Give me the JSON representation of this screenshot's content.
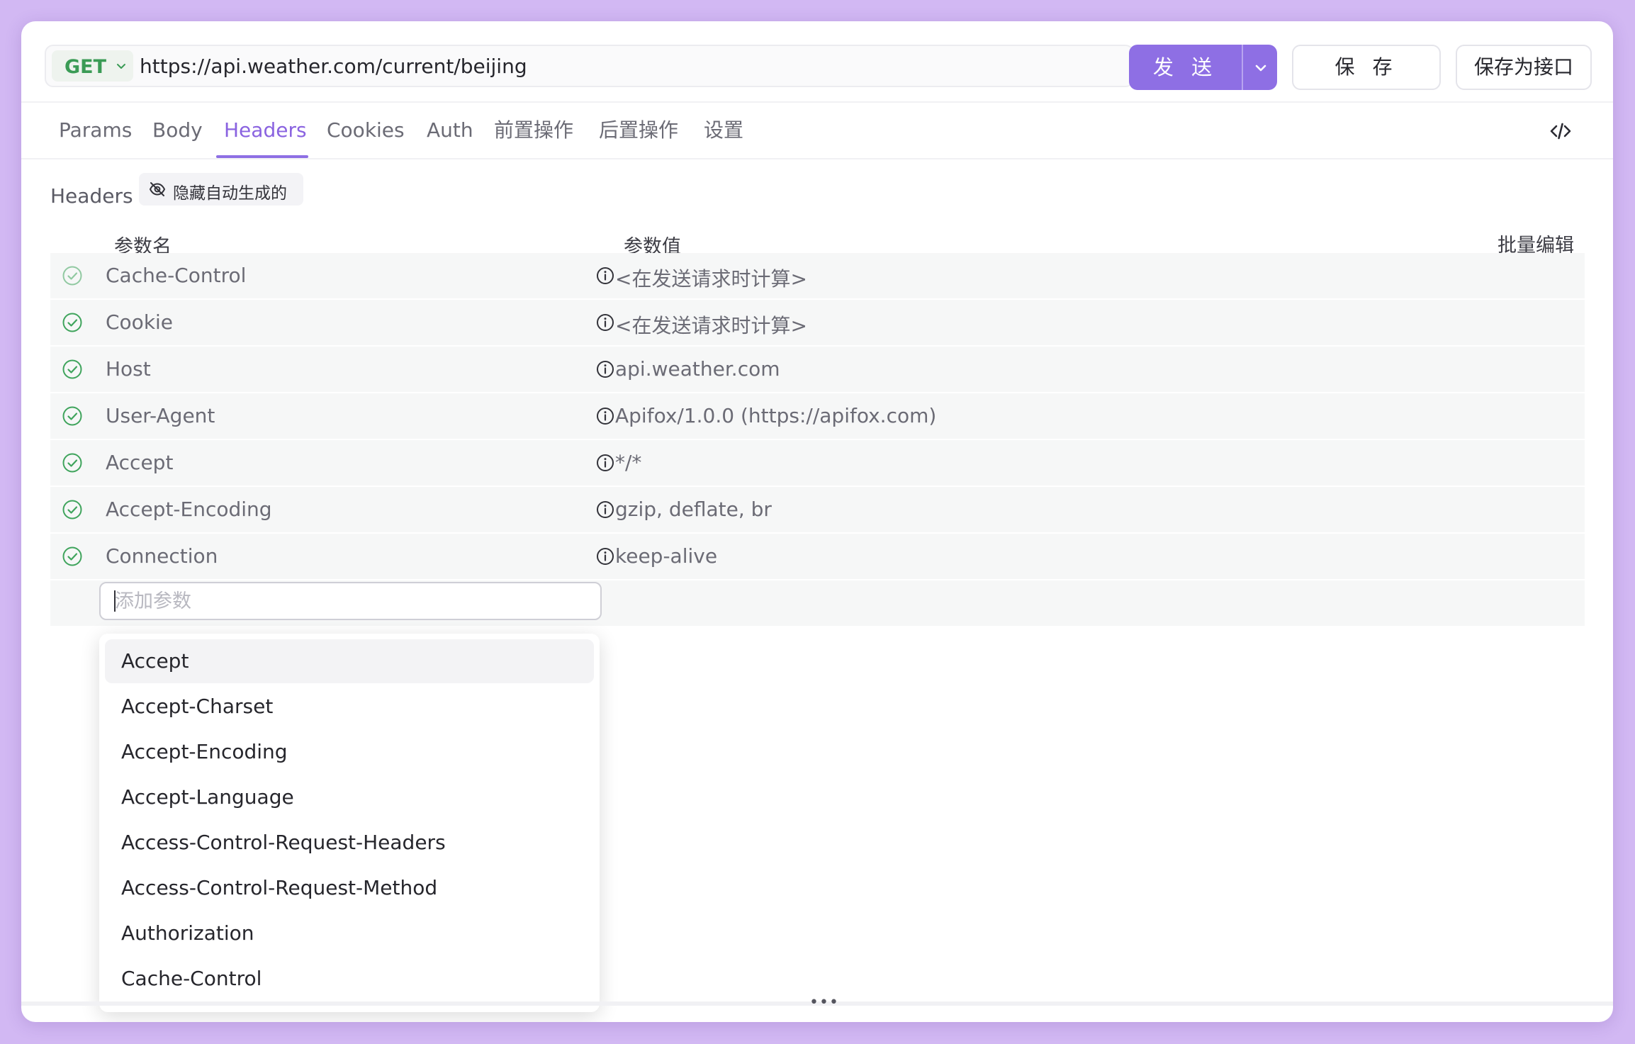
{
  "request": {
    "method": "GET",
    "url": "https://api.weather.com/current/beijing",
    "send_label": "发 送",
    "save_label": "保 存",
    "save_as_api_label": "保存为接口"
  },
  "tabs": [
    {
      "label": "Params"
    },
    {
      "label": "Body"
    },
    {
      "label": "Headers",
      "active": true
    },
    {
      "label": "Cookies"
    },
    {
      "label": "Auth"
    },
    {
      "label": "前置操作"
    },
    {
      "label": "后置操作"
    },
    {
      "label": "设置"
    }
  ],
  "headers_section": {
    "title": "Headers",
    "hide_auto_label": "隐藏自动生成的",
    "col_name": "参数名",
    "col_value": "参数值",
    "bulk_edit": "批量编辑",
    "rows": [
      {
        "name": "Cache-Control",
        "value": "<在发送请求时计算>",
        "checked": true
      },
      {
        "name": "Cookie",
        "value": "<在发送请求时计算>",
        "checked": true
      },
      {
        "name": "Host",
        "value": "api.weather.com",
        "checked": true
      },
      {
        "name": "User-Agent",
        "value": "Apifox/1.0.0 (https://apifox.com)",
        "checked": true
      },
      {
        "name": "Accept",
        "value": "*/*",
        "checked": true
      },
      {
        "name": "Accept-Encoding",
        "value": "gzip, deflate, br",
        "checked": true
      },
      {
        "name": "Connection",
        "value": "keep-alive",
        "checked": true
      }
    ],
    "add_placeholder": "添加参数"
  },
  "suggestions": [
    "Accept",
    "Accept-Charset",
    "Accept-Encoding",
    "Accept-Language",
    "Access-Control-Request-Headers",
    "Access-Control-Request-Method",
    "Authorization",
    "Cache-Control"
  ],
  "colors": {
    "accent": "#8e6fe4",
    "method_get": "#3a9b55",
    "check_green": "#3fa45c",
    "background": "#d2b8f3"
  }
}
